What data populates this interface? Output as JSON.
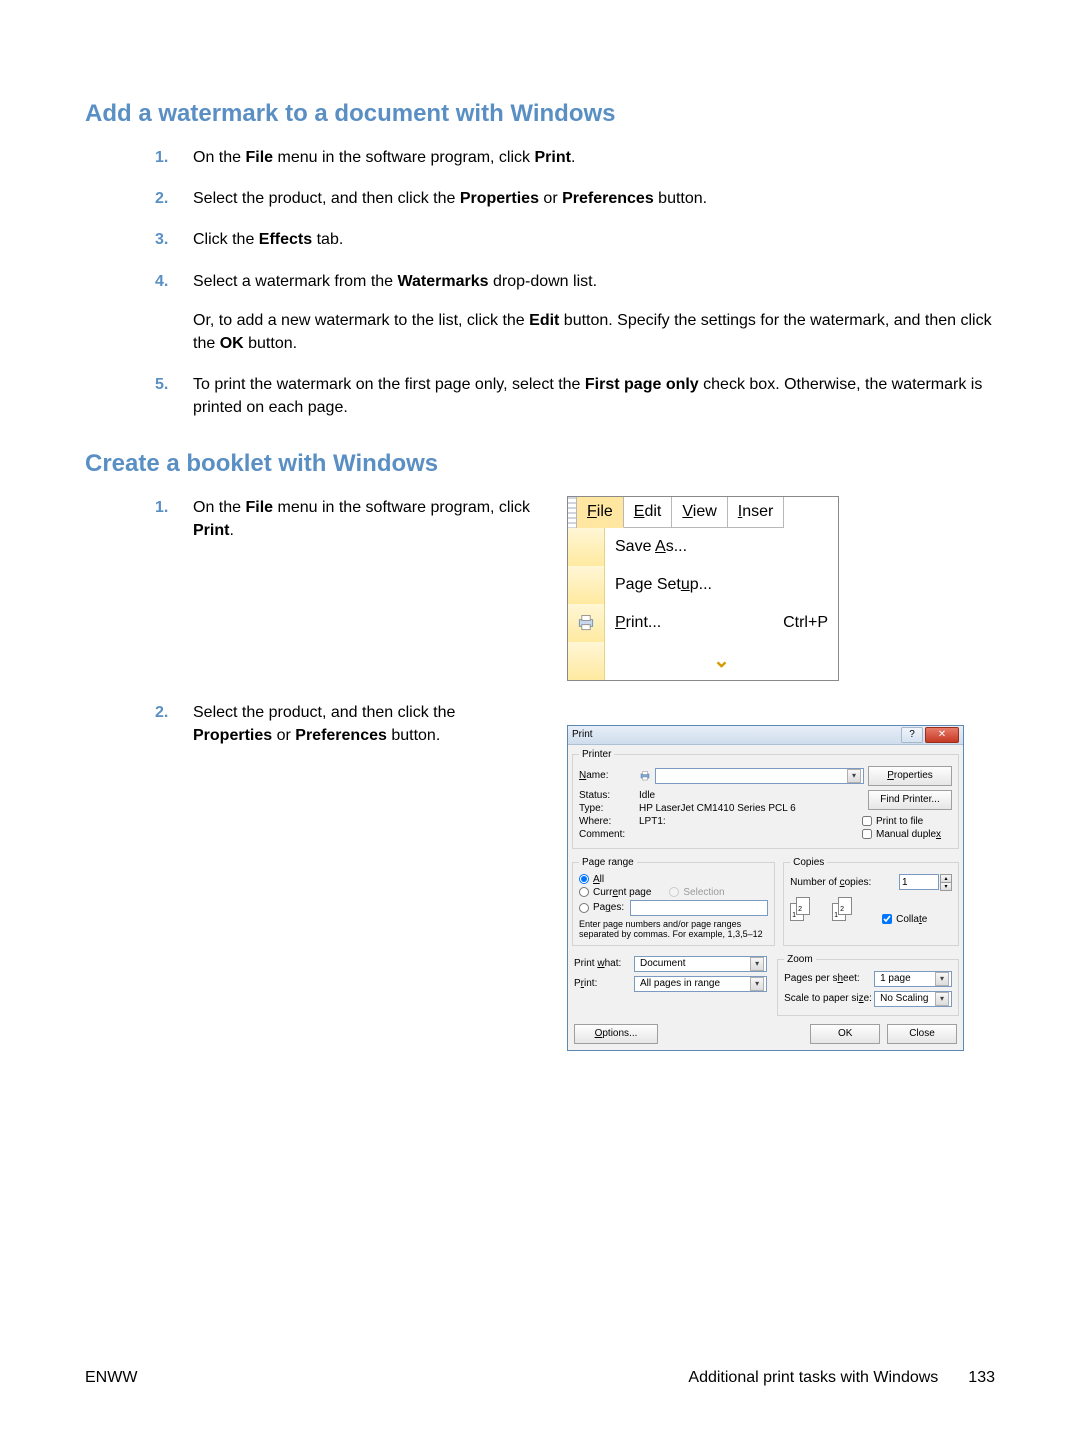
{
  "heading1": "Add a watermark to a document with Windows",
  "steps1": [
    {
      "n": "1.",
      "parts": [
        [
          "On the "
        ],
        [
          "b",
          "File"
        ],
        [
          " menu in the software program, click "
        ],
        [
          "b",
          "Print"
        ],
        [
          "."
        ]
      ]
    },
    {
      "n": "2.",
      "parts": [
        [
          "Select the product, and then click the "
        ],
        [
          "b",
          "Properties"
        ],
        [
          " or "
        ],
        [
          "b",
          "Preferences"
        ],
        [
          " button."
        ]
      ]
    },
    {
      "n": "3.",
      "parts": [
        [
          "Click the "
        ],
        [
          "b",
          "Effects"
        ],
        [
          " tab."
        ]
      ]
    },
    {
      "n": "4.",
      "parts": [
        [
          "Select a watermark from the "
        ],
        [
          "b",
          "Watermarks"
        ],
        [
          " drop-down list."
        ]
      ],
      "extra": [
        [
          "Or, to add a new watermark to the list, click the "
        ],
        [
          "b",
          "Edit"
        ],
        [
          " button. Specify the settings for the watermark, and then click the "
        ],
        [
          "b",
          "OK"
        ],
        [
          " button."
        ]
      ]
    },
    {
      "n": "5.",
      "parts": [
        [
          "To print the watermark on the first page only, select the "
        ],
        [
          "b",
          "First page only"
        ],
        [
          " check box. Otherwise, the watermark is printed on each page."
        ]
      ]
    }
  ],
  "heading2": "Create a booklet with Windows",
  "steps2a": [
    {
      "n": "1.",
      "parts": [
        [
          "On the "
        ],
        [
          "b",
          "File"
        ],
        [
          " menu in the software program, click "
        ],
        [
          "b",
          "Print"
        ],
        [
          "."
        ]
      ]
    }
  ],
  "steps2b": [
    {
      "n": "2.",
      "parts": [
        [
          "Select the product, and then click the "
        ],
        [
          "b",
          "Properties"
        ],
        [
          " or "
        ],
        [
          "b",
          "Preferences"
        ],
        [
          " button."
        ]
      ]
    }
  ],
  "menu": {
    "tabs": [
      "File",
      "Edit",
      "View",
      "Inser"
    ],
    "items": [
      {
        "label": "Save As...",
        "u": "A"
      },
      {
        "label": "Page Setup...",
        "u": "u"
      },
      {
        "label": "Print...",
        "u": "P",
        "accel": "Ctrl+P",
        "icon": "printer"
      }
    ]
  },
  "printDialog": {
    "title": "Print",
    "printer": {
      "legend": "Printer",
      "nameLabel": "Name:",
      "statusLabel": "Status:",
      "statusValue": "Idle",
      "typeLabel": "Type:",
      "typeValue": "HP LaserJet CM1410 Series PCL 6",
      "whereLabel": "Where:",
      "whereValue": "LPT1:",
      "commentLabel": "Comment:",
      "propertiesBtn": "Properties",
      "findPrinterBtn": "Find Printer...",
      "printToFile": "Print to file",
      "manualDuplex": "Manual duplex"
    },
    "pageRange": {
      "legend": "Page range",
      "all": "All",
      "currentPage": "Current page",
      "selection": "Selection",
      "pages": "Pages:",
      "hint": "Enter page numbers and/or page ranges separated by commas. For example, 1,3,5–12"
    },
    "copies": {
      "legend": "Copies",
      "numberLabel": "Number of copies:",
      "numberValue": "1",
      "collate": "Collate"
    },
    "printWhatLabel": "Print what:",
    "printWhatValue": "Document",
    "printLabel": "Print:",
    "printValue": "All pages in range",
    "zoom": {
      "legend": "Zoom",
      "ppsLabel": "Pages per sheet:",
      "ppsValue": "1 page",
      "scaleLabel": "Scale to paper size:",
      "scaleValue": "No Scaling"
    },
    "optionsBtn": "Options...",
    "okBtn": "OK",
    "closeBtn": "Close"
  },
  "footer": {
    "left": "ENWW",
    "rightText": "Additional print tasks with Windows",
    "pageNum": "133"
  }
}
